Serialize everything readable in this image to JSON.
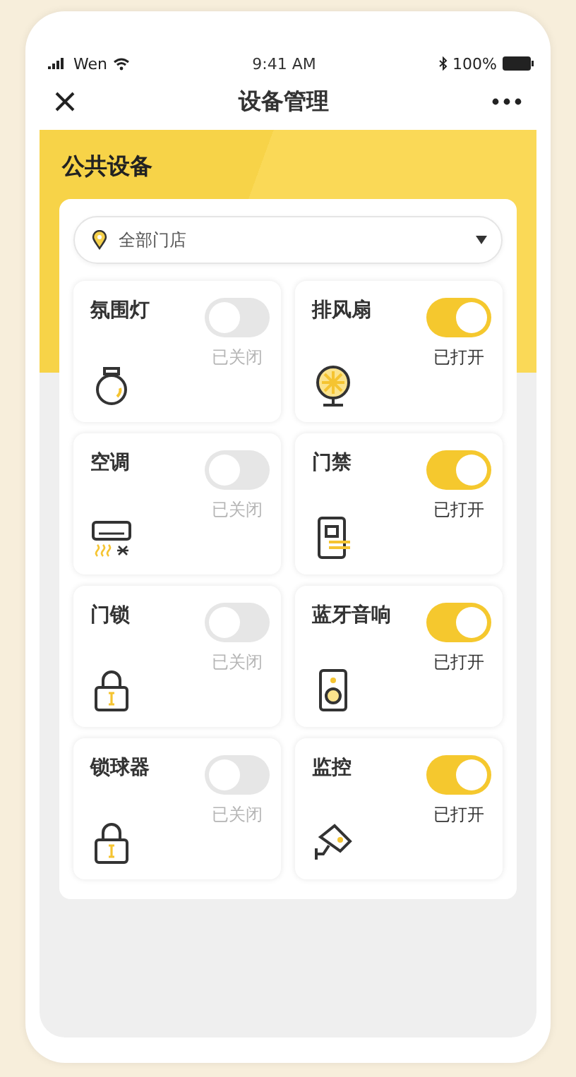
{
  "status_bar": {
    "carrier": "Wen",
    "time": "9:41 AM",
    "battery": "100%"
  },
  "nav": {
    "title": "设备管理"
  },
  "section_title": "公共设备",
  "store_select": {
    "value": "全部门店"
  },
  "devices": [
    {
      "name": "氛围灯",
      "kind": "bulb",
      "on": false,
      "status": "已关闭"
    },
    {
      "name": "排风扇",
      "kind": "fan",
      "on": true,
      "status": "已打开"
    },
    {
      "name": "空调",
      "kind": "ac",
      "on": false,
      "status": "已关闭"
    },
    {
      "name": "门禁",
      "kind": "door",
      "on": true,
      "status": "已打开"
    },
    {
      "name": "门锁",
      "kind": "lock",
      "on": false,
      "status": "已关闭"
    },
    {
      "name": "蓝牙音响",
      "kind": "speaker",
      "on": true,
      "status": "已打开"
    },
    {
      "name": "锁球器",
      "kind": "lock",
      "on": false,
      "status": "已关闭"
    },
    {
      "name": "监控",
      "kind": "camera",
      "on": true,
      "status": "已打开"
    }
  ]
}
